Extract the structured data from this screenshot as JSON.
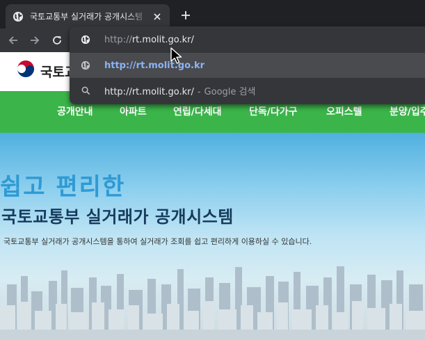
{
  "browser": {
    "tab": {
      "title": "국토교통부 실거래가 공개시스템"
    },
    "omnibox": {
      "input_scheme": "http://",
      "input_host": "rt.molit.go.kr/",
      "suggestions": [
        {
          "url": "http://rt.molit.go.kr"
        },
        {
          "query": "http://rt.molit.go.kr/",
          "separator": "-",
          "description": "Google 검색"
        }
      ]
    }
  },
  "site": {
    "logo_text": "국토교",
    "nav": [
      "공개안내",
      "아파트",
      "연립/다세대",
      "단독/다가구",
      "오피스텔",
      "분양/입주"
    ],
    "hero": {
      "subtitle": "쉽고 편리한",
      "title": "국토교통부 실거래가 공개시스템",
      "description": "국토교통부 실거래가 공개시스템을 통하여 실거래가 조회를 쉽고 편리하게 이용하실 수 있습니다."
    }
  },
  "colors": {
    "nav_green": "#3bb54a",
    "hero_sky": "#4fb0df",
    "title_navy": "#163a5c",
    "suggest_blue": "#8ab4f8"
  }
}
